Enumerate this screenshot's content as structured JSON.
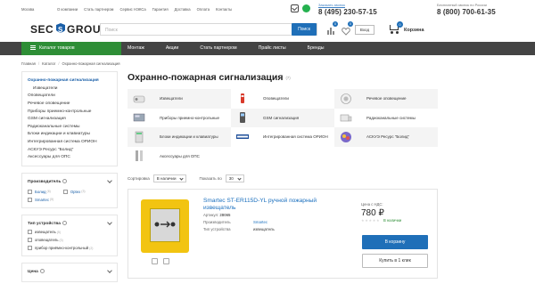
{
  "topbar": {
    "city": "Москва",
    "links": [
      "О компании",
      "Стать партнером",
      "Сервис НЭКСа",
      "Гарантия",
      "Доставка",
      "Оплата",
      "Контакты"
    ],
    "callback_label": "Заказать звонок",
    "phone_main": "8 (495) 230-57-15",
    "free_call_label": "Бесплатный звонок по России",
    "phone_free": "8 (800) 700-61-35"
  },
  "header": {
    "logo_text": "SEC GROUP",
    "search_placeholder": "Поиск",
    "search_button": "Поиск",
    "login": "Вход",
    "cart_label": "Корзина",
    "cart_count": "0",
    "compare_count": "0",
    "favorites_count": "0"
  },
  "nav": {
    "catalog": "Каталог товаров",
    "items": [
      "Монтаж",
      "Акции",
      "Стать партнером",
      "Прайс листы",
      "Бренды"
    ]
  },
  "breadcrumb": [
    "Главная",
    "Каталог",
    "Охранно-пожарная сигнализация"
  ],
  "sidebar": {
    "head": "Охранно-пожарная сигнализация",
    "items": [
      "Извещатели",
      "Оповещатели",
      "Речевое оповещение",
      "Приборы приемно-контрольные",
      "GSM сигнализация",
      "Радиоканальные системы",
      "Блоки индикации и клавиатуры",
      "Интегрированная система ОРИОН",
      "АСКУЭ Ресурс \"Болид\"",
      "Аксессуары для ОПС"
    ]
  },
  "filters": {
    "manufacturer": {
      "title": "Производитель",
      "options": [
        {
          "label": "Болид",
          "count": "(6)"
        },
        {
          "label": "Optex",
          "count": "(3)"
        },
        {
          "label": "Smartec",
          "count": "(5)"
        }
      ]
    },
    "device_type": {
      "title": "Тип устройства",
      "options": [
        {
          "label": "извещатель",
          "count": "(5)"
        },
        {
          "label": "оповещатель",
          "count": "(3)"
        },
        {
          "label": "прибор приёмно-контрольный",
          "count": "(2)"
        }
      ]
    },
    "price": {
      "title": "Цена"
    }
  },
  "main": {
    "title": "Охранно-пожарная сигнализация",
    "count": "(7)",
    "categories": [
      "Извещатели",
      "Оповещатели",
      "Речевое оповещение",
      "Приборы приемно-контрольные",
      "GSM сигнализация",
      "Радиоканальные системы",
      "Блоки индикации и клавиатуры",
      "Интегрированная система ОРИОН",
      "АСКУЭ Ресурс \"Болид\"",
      "Аксессуары для ОПС"
    ],
    "sort_label": "Сортировка",
    "sort_value": "В наличии",
    "show_label": "Показать по",
    "show_value": "30"
  },
  "product": {
    "name": "Smartec ST-ER115D-YL ручной пожарный извещатель",
    "article_label": "Артикул:",
    "article": "28065",
    "manufacturer_label": "Производитель",
    "manufacturer": "Smartec",
    "type_label": "Тип устройства",
    "type": "извещатель",
    "price_label": "Цена с НДС:",
    "price": "780 ₽",
    "stock": "В наличии",
    "cart_button": "В корзину",
    "one_click_button": "Купить в 1 клик"
  },
  "colors": {
    "brand_blue": "#1f6fb8",
    "catalog_green": "#2e8e36",
    "nav_dark": "#444444",
    "product_yellow": "#f2c411"
  }
}
